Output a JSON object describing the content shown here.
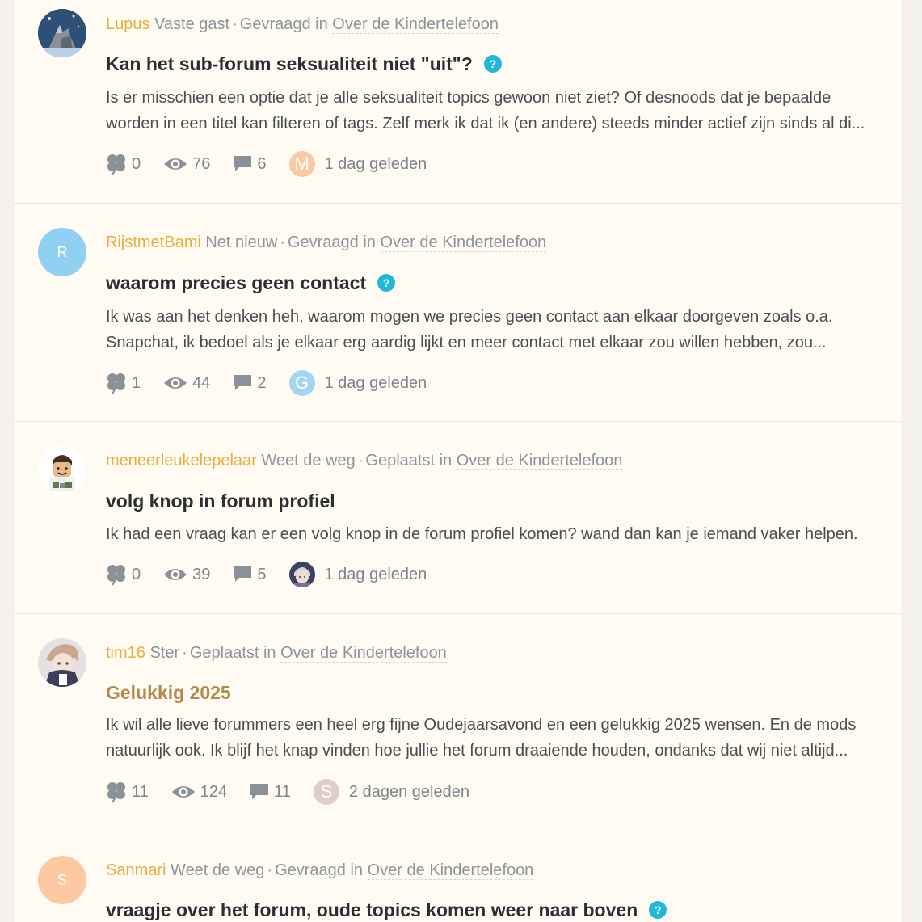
{
  "posts": [
    {
      "author": "Lupus",
      "rank": "Vaste gast",
      "action": "Gevraagd in",
      "forum": "Over de Kindertelefoon",
      "title": "Kan het sub-forum seksualiteit niet \"uit\"?",
      "question": true,
      "help_icon": "?",
      "excerpt": [
        "Is er misschien een optie dat je alle seksualiteit topics gewoon niet ziet? Of desnoods dat je bepaalde",
        "worden in een titel kan filteren of tags. Zelf merk ik dat ik (en andere) steeds minder actief zijn sinds al di..."
      ],
      "likes": "0",
      "views": "76",
      "replies": "6",
      "last_avatar_letter": "M",
      "time": "1 dag geleden"
    },
    {
      "author": "RijstmetBami",
      "rank": "Net nieuw",
      "action": "Gevraagd in",
      "forum": "Over de Kindertelefoon",
      "avatar_letter": "R",
      "title": "waarom precies geen contact",
      "question": true,
      "help_icon": "?",
      "excerpt": [
        "Ik was aan het denken heh, waarom mogen we precies geen contact aan elkaar doorgeven zoals o.a.",
        "Snapchat, ik bedoel als je elkaar erg aardig lijkt en meer contact met elkaar zou willen hebben, zou..."
      ],
      "likes": "1",
      "views": "44",
      "replies": "2",
      "last_avatar_letter": "G",
      "time": "1 dag geleden"
    },
    {
      "author": "meneerleukelepelaar",
      "rank": "Weet de weg",
      "action": "Geplaatst in",
      "forum": "Over de Kindertelefoon",
      "title": "volg knop in forum profiel",
      "question": false,
      "excerpt": [
        "Ik had een vraag kan er een volg knop in de forum profiel komen? wand dan kan je iemand vaker helpen."
      ],
      "likes": "0",
      "views": "39",
      "replies": "5",
      "time": "1 dag geleden"
    },
    {
      "author": "tim16",
      "rank": "Ster",
      "action": "Geplaatst in",
      "forum": "Over de Kindertelefoon",
      "title": "Gelukkig 2025",
      "question": false,
      "excerpt": [
        "Ik wil alle lieve forummers een heel erg fijne Oudejaarsavond en een gelukkig 2025 wensen. En de mods",
        "natuurlijk ook. Ik blijf het knap vinden hoe jullie het forum draaiende houden, ondanks dat wij niet altijd..."
      ],
      "likes": "11",
      "views": "124",
      "replies": "11",
      "last_avatar_letter": "S",
      "time": "2 dagen geleden"
    },
    {
      "author": "Sanmari",
      "rank": "Weet de weg",
      "action": "Gevraagd in",
      "forum": "Over de Kindertelefoon",
      "avatar_letter": "S",
      "title": "vraagje over het forum, oude topics komen weer naar boven",
      "question": true,
      "help_icon": "?"
    }
  ],
  "colors": {
    "author": "#e8ae3b",
    "help_icon": "#1fb8d9",
    "highlight_title": "#b4894b",
    "avatar_r": "#8fd0f3",
    "avatar_s": "#fcc9a3",
    "avatar_m": "#f9c9a3",
    "avatar_g": "#a3d5f3",
    "avatar_s2": "#e0cdca"
  },
  "icons": {
    "like": "clover-icon",
    "views": "eye-icon",
    "replies": "comment-icon"
  }
}
